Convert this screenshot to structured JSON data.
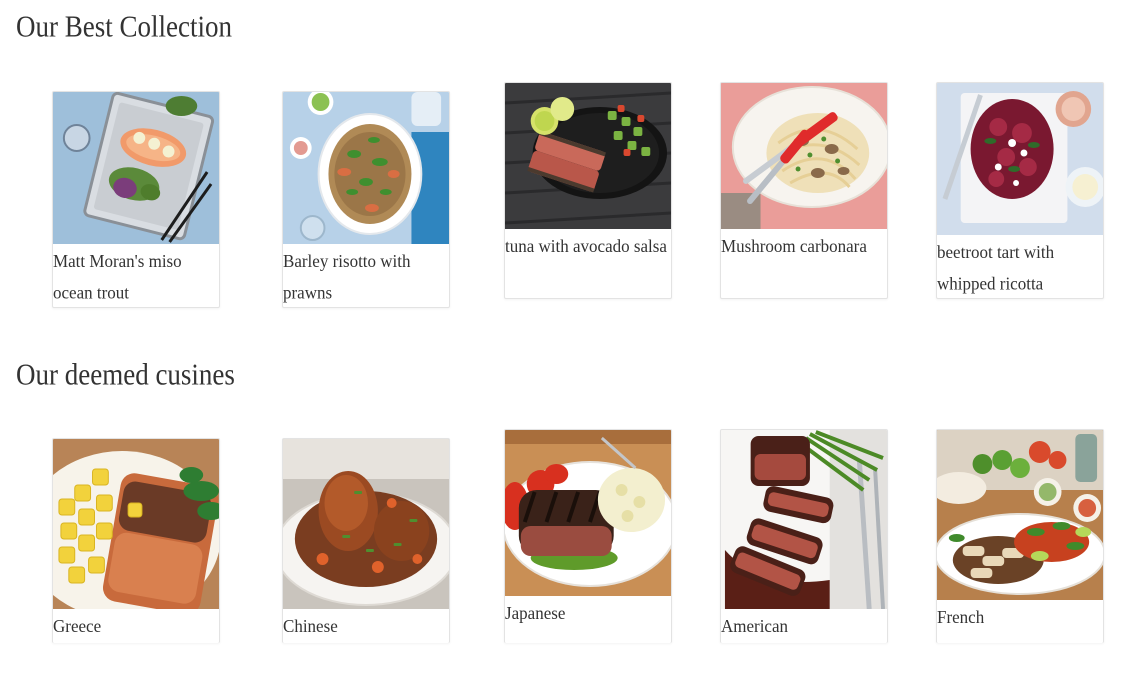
{
  "best_collection": {
    "title": "Our Best Collection",
    "items": [
      {
        "caption": "Matt Moran's miso ocean trout",
        "image": "miso-ocean-trout-photo"
      },
      {
        "caption": "Barley risotto with prawns",
        "image": "barley-risotto-photo"
      },
      {
        "caption": "tuna with avocado salsa",
        "image": "tuna-avocado-salsa-photo"
      },
      {
        "caption": "Mushroom carbonara",
        "image": "mushroom-carbonara-photo"
      },
      {
        "caption": "beetroot tart with whipped ricotta",
        "image": "beetroot-tart-photo"
      }
    ]
  },
  "deemed_cuisines": {
    "title": "Our deemed cusines",
    "items": [
      {
        "caption": "Greece",
        "image": "greek-salmon-photo"
      },
      {
        "caption": "Chinese",
        "image": "chinese-chicken-photo"
      },
      {
        "caption": "Japanese",
        "image": "japanese-steak-photo"
      },
      {
        "caption": "American",
        "image": "american-steak-photo"
      },
      {
        "caption": "French",
        "image": "french-chicken-photo"
      }
    ]
  }
}
